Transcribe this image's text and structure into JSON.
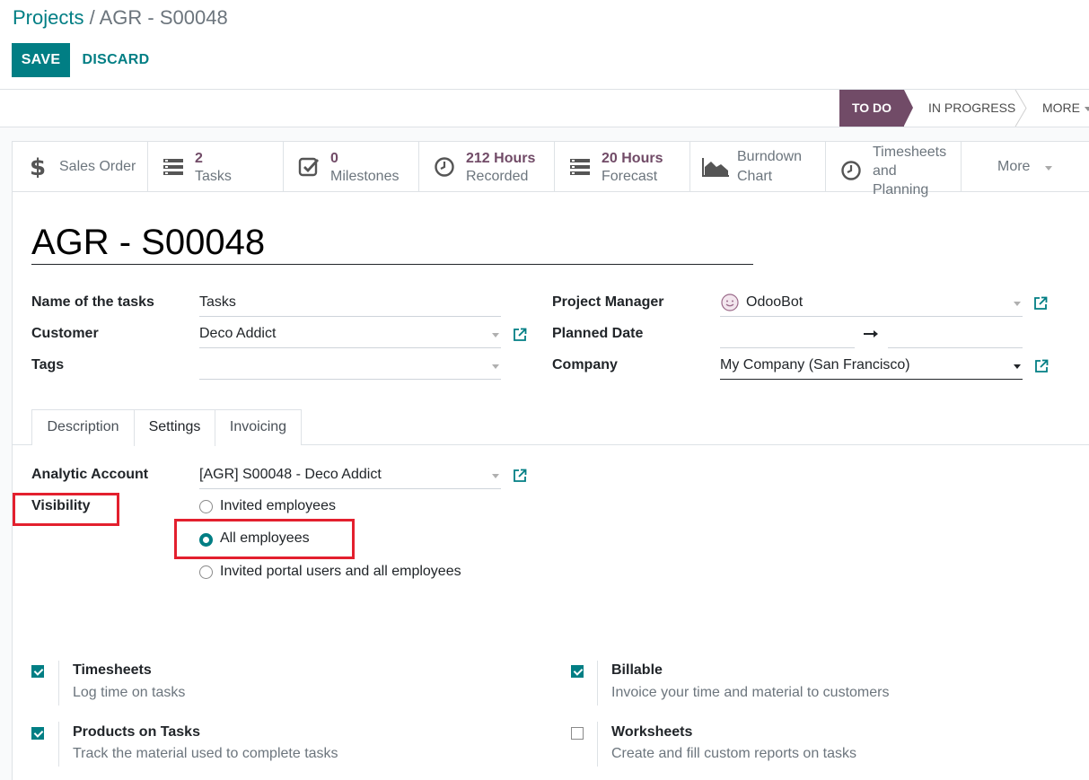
{
  "breadcrumb": {
    "parent": "Projects",
    "separator": " / ",
    "current": "AGR - S00048"
  },
  "toolbar": {
    "save_label": "SAVE",
    "discard_label": "DISCARD"
  },
  "stages": {
    "active": "TO DO",
    "next": "IN PROGRESS",
    "more": "MORE"
  },
  "smart_buttons": {
    "sales_order": {
      "label": "Sales Order",
      "icon": "dollar-icon"
    },
    "tasks": {
      "value": "2",
      "label": "Tasks",
      "icon": "tasks-icon"
    },
    "milestones": {
      "value": "0",
      "label": "Milestones",
      "icon": "check-square-icon"
    },
    "recorded": {
      "value": "212 Hours",
      "label": "Recorded",
      "icon": "clock-icon"
    },
    "forecast": {
      "value": "20 Hours",
      "label": "Forecast",
      "icon": "tasks-icon"
    },
    "burndown": {
      "line1": "Burndown",
      "line2": "Chart",
      "icon": "area-chart-icon"
    },
    "timesheets": {
      "line1": "Timesheets",
      "line2": "and",
      "line3": "Planning",
      "icon": "clock-icon"
    },
    "more": {
      "label": "More"
    }
  },
  "project": {
    "name": "AGR - S00048",
    "fields": {
      "name_of_tasks": {
        "label": "Name of the tasks",
        "value": "Tasks"
      },
      "customer": {
        "label": "Customer",
        "value": "Deco Addict"
      },
      "tags": {
        "label": "Tags",
        "value": ""
      },
      "project_manager": {
        "label": "Project Manager",
        "value": "OdooBot"
      },
      "planned_date": {
        "label": "Planned Date",
        "start": "",
        "end": ""
      },
      "company": {
        "label": "Company",
        "value": "My Company (San Francisco)"
      }
    }
  },
  "tabs": [
    "Description",
    "Settings",
    "Invoicing"
  ],
  "settings": {
    "analytic_account": {
      "label": "Analytic Account",
      "value": "[AGR] S00048 - Deco Addict"
    },
    "visibility": {
      "label": "Visibility",
      "selected": "All employees",
      "options": [
        "Invited employees",
        "All employees",
        "Invited portal users and all employees"
      ]
    },
    "options": [
      {
        "title": "Timesheets",
        "desc": "Log time on tasks",
        "checked": true
      },
      {
        "title": "Billable",
        "desc": "Invoice your time and material to customers",
        "checked": true
      },
      {
        "title": "Products on Tasks",
        "desc": "Track the material used to complete tasks",
        "checked": true
      },
      {
        "title": "Worksheets",
        "desc": "Create and fill custom reports on tasks",
        "checked": false
      }
    ]
  },
  "colors": {
    "primary": "#017e84",
    "brand": "#714b67",
    "highlight": "#e3202e"
  }
}
